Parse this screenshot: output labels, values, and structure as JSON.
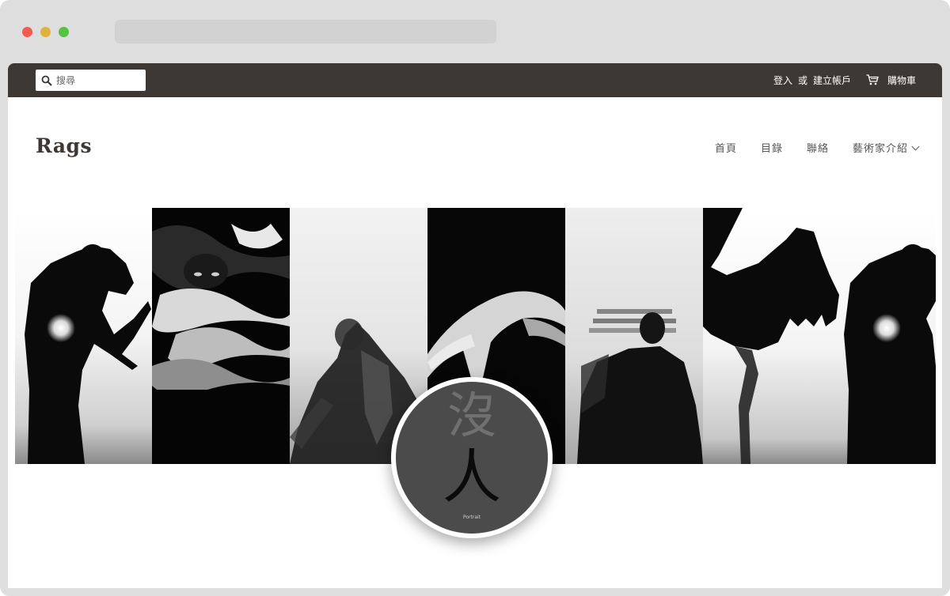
{
  "search": {
    "placeholder": "搜尋"
  },
  "account": {
    "login_label": "登入",
    "or_label": "或",
    "register_label": "建立帳戶"
  },
  "cart": {
    "label": "購物車",
    "icon": "cart-icon"
  },
  "brand": {
    "name": "Rags"
  },
  "nav": {
    "items": [
      {
        "label": "首頁"
      },
      {
        "label": "目錄"
      },
      {
        "label": "聯絡"
      },
      {
        "label": "藝術家介紹"
      }
    ]
  },
  "portrait": {
    "char_top": "沒",
    "char_bottom": "人",
    "caption": "Portrait"
  },
  "colors": {
    "topbar": "#3e3834",
    "brand_text": "#3e3834",
    "nav_text": "#555555",
    "circle_bg": "#4b4b4b"
  }
}
